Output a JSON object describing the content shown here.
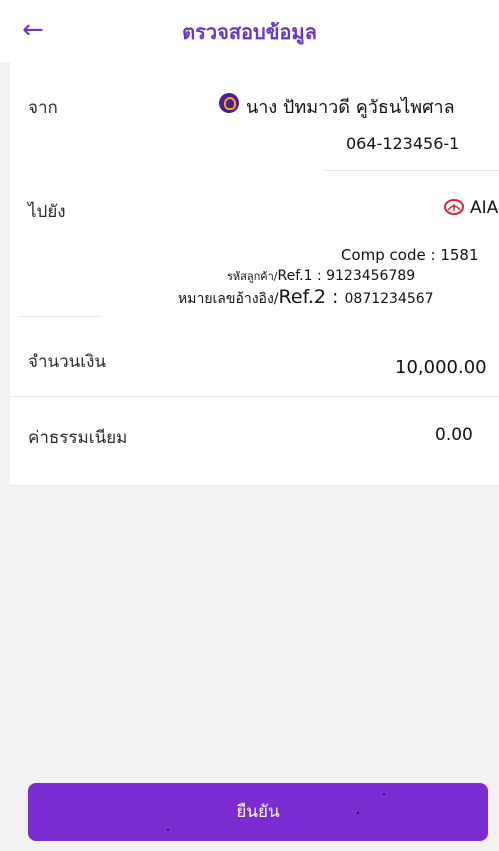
{
  "header": {
    "title": "ตรวจสอบข้อมูล",
    "back_icon": "back-arrow-icon"
  },
  "from": {
    "label": "จาก",
    "name": "นาง ปัทมาวดี คูวัธนไพศาล",
    "account": "064-123456-1",
    "avatar_icon": "bank-logo-icon"
  },
  "to": {
    "label": "ไปยัง",
    "name": "AIA",
    "logo_icon": "aia-logo-icon",
    "comp_code": "Comp code : 1581",
    "ref1_prefix": "รหัสลูกค้า/",
    "ref1_value": "Ref.1 : 9123456789",
    "ref2_prefix": "หมายเลขอ้างอิง/",
    "ref2_ref": "Ref.2",
    "ref2_sep": " : ",
    "ref2_value": "0871234567"
  },
  "amount": {
    "label": "จำนวนเงิน",
    "value": "10,000.00"
  },
  "fee": {
    "label": "ค่าธรรมเนียม",
    "value": "0.00"
  },
  "confirm_button": {
    "label": "ยืนยัน"
  },
  "colors": {
    "accent": "#6a35c9",
    "button": "#7b2cd0",
    "aia_red": "#d7263d"
  }
}
